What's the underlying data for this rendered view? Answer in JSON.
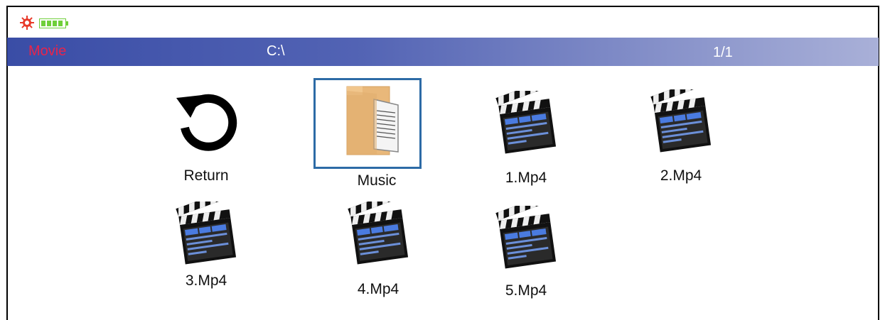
{
  "status": {
    "gear_icon": "gear-icon",
    "battery_icon": "battery-icon",
    "battery_color": "#6fcf3a",
    "gear_color": "#e83a2a"
  },
  "bar": {
    "title": "Movie",
    "path": "C:\\",
    "page": "1/1"
  },
  "items": [
    {
      "label": "Return",
      "icon": "return-icon",
      "selected": false
    },
    {
      "label": "Music",
      "icon": "folder-icon",
      "selected": true
    },
    {
      "label": "1.Mp4",
      "icon": "clapperboard-icon",
      "selected": false
    },
    {
      "label": "2.Mp4",
      "icon": "clapperboard-icon",
      "selected": false
    },
    {
      "label": "3.Mp4",
      "icon": "clapperboard-icon",
      "selected": false
    },
    {
      "label": "4.Mp4",
      "icon": "clapperboard-icon",
      "selected": false
    },
    {
      "label": "5.Mp4",
      "icon": "clapperboard-icon",
      "selected": false
    }
  ],
  "colors": {
    "bar_start": "#3a4da6",
    "bar_end": "#a9b0d8",
    "title": "#e8244b",
    "selection_border": "#2d6ba6",
    "folder": "#e9b87a"
  }
}
